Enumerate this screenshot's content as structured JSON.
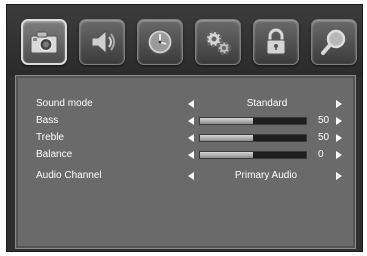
{
  "tabs": [
    {
      "name": "picture",
      "icon": "camera-icon",
      "selected": true
    },
    {
      "name": "sound",
      "icon": "speaker-icon",
      "selected": false
    },
    {
      "name": "time",
      "icon": "clock-icon",
      "selected": false
    },
    {
      "name": "setup",
      "icon": "gears-icon",
      "selected": false
    },
    {
      "name": "lock",
      "icon": "padlock-icon",
      "selected": false
    },
    {
      "name": "search",
      "icon": "magnifier-icon",
      "selected": false
    }
  ],
  "sound_menu": {
    "sound_mode": {
      "label": "Sound mode",
      "value": "Standard"
    },
    "bass": {
      "label": "Bass",
      "value": "50",
      "level": 0.5
    },
    "treble": {
      "label": "Treble",
      "value": "50",
      "level": 0.5
    },
    "balance": {
      "label": "Balance",
      "value": "0",
      "level": 0.5
    },
    "audio_channel": {
      "label": "Audio Channel",
      "value": "Primary Audio"
    }
  }
}
